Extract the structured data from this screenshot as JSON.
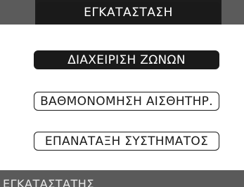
{
  "header": {
    "title": "ΕΓΚΑΤΑΣΤΑΣΗ"
  },
  "menu": {
    "items": [
      {
        "label": "ΔΙΑΧΕΙΡΙΣΗ ΖΩΝΩΝ",
        "selected": true
      },
      {
        "label": "ΒΑΘΜΟΝΟΜΗΣΗ ΑΙΣΘΗΤΗΡ.",
        "selected": false
      },
      {
        "label": "ΕΠΑΝΑΤΑΞΗ ΣΥΣΤΗΜΑΤΟΣ",
        "selected": false
      }
    ]
  },
  "status": {
    "label": "ΕΓΚΑΤΑΣΤΑΤΗΣ"
  },
  "colors": {
    "dark": "#1a1a1a",
    "bar_gray": "#5a5a5a",
    "background": "#ffffff"
  }
}
